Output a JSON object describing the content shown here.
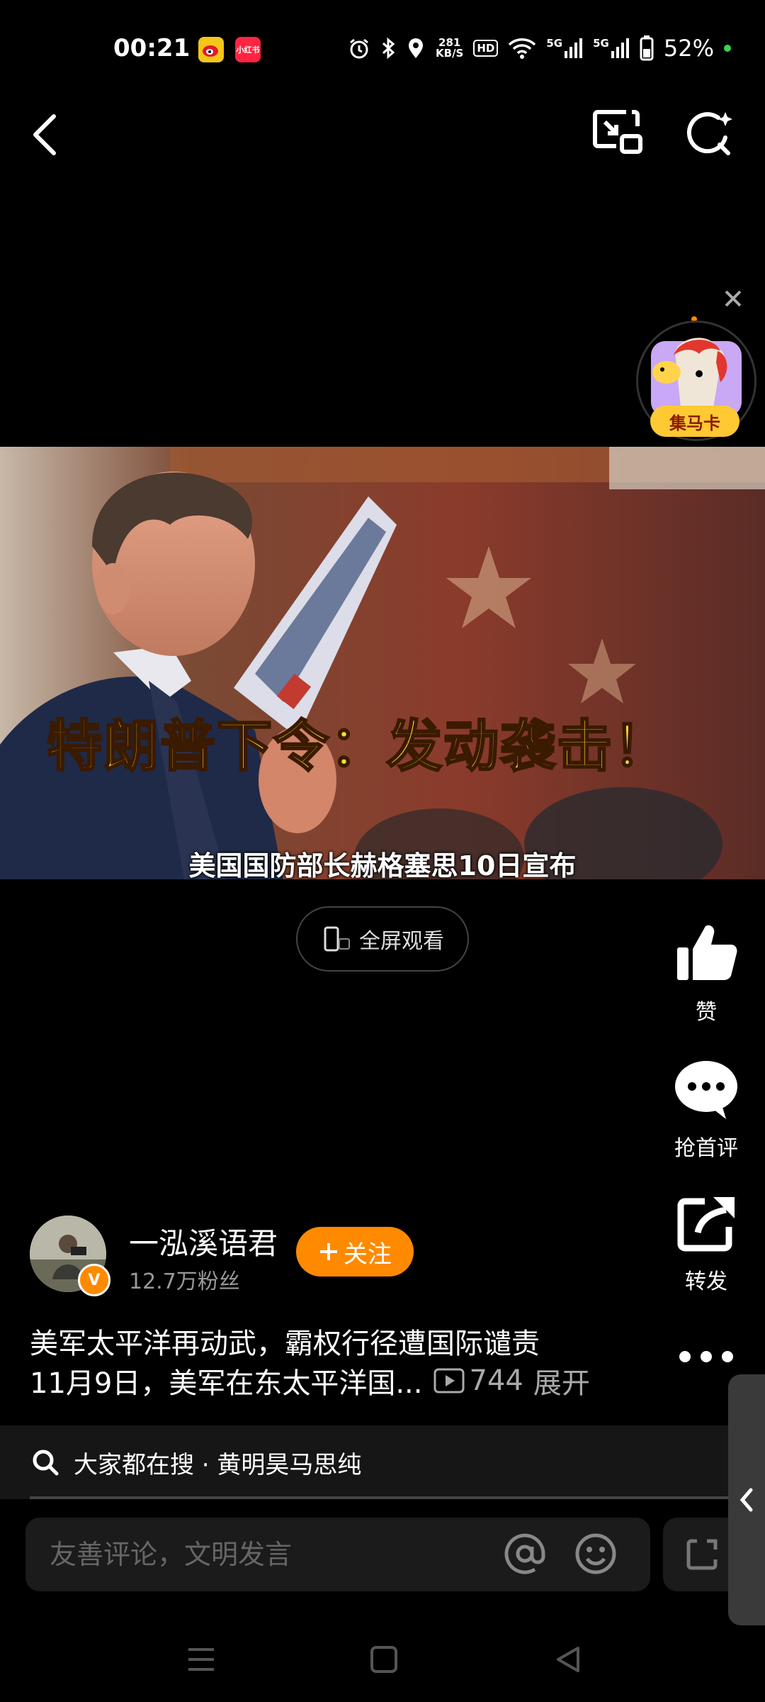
{
  "status_bar": {
    "time": "00:21",
    "app_badge_2": "小红书",
    "speed_value": "281",
    "speed_unit": "KB/S",
    "hd_label": "HD",
    "network_1": "5G",
    "network_2": "5G",
    "battery": "52%"
  },
  "video": {
    "headline": "特朗普下令：发动袭击！",
    "subtitle": "美国国防部长赫格塞思10日宣布",
    "fullscreen_label": "全屏观看"
  },
  "promo": {
    "label": "集马卡"
  },
  "actions": {
    "like_label": "赞",
    "comment_label": "抢首评",
    "share_label": "转发"
  },
  "author": {
    "name": "一泓溪语君",
    "followers": "12.7万粉丝",
    "follow_label": "关注"
  },
  "post": {
    "line1": "美军太平洋再动武，霸权行径遭国际谴责",
    "line2": "11月9日，美军在东太平洋国...",
    "views": "744",
    "expand": "展开"
  },
  "search_suggest": {
    "text": "大家都在搜 · 黄明昊马思纯"
  },
  "comment": {
    "placeholder": "友善评论，文明发言"
  },
  "colors": {
    "accent": "#ff8a00",
    "headline": "#ffd93a",
    "background": "#000000"
  }
}
